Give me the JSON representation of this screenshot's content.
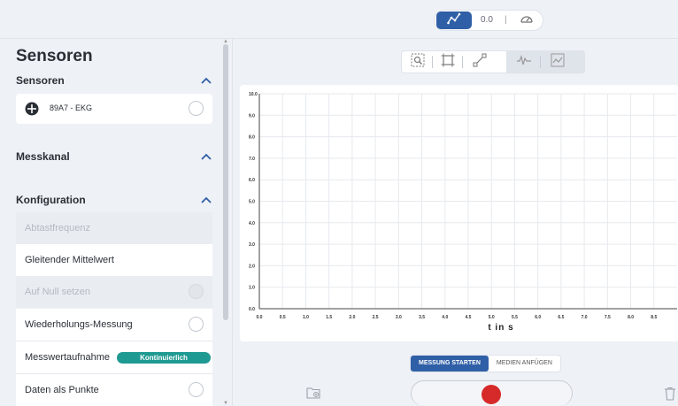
{
  "topbar": {
    "mode_value": "0.0",
    "mode_separator": "|",
    "icons": [
      "graph-mode-icon",
      "gauge-icon"
    ]
  },
  "sidebar": {
    "title": "Sensoren",
    "sensors": {
      "header": "Sensoren",
      "items": [
        {
          "label": "89A7 - EKG",
          "icon": "sensor-icon"
        }
      ]
    },
    "channel": {
      "header": "Messkanal"
    },
    "config": {
      "header": "Konfiguration",
      "rows": [
        {
          "label": "Abtastfrequenz"
        },
        {
          "label": "Gleitender Mittelwert"
        },
        {
          "label": "Auf Null setzen"
        },
        {
          "label": "Wiederholungs-Messung"
        },
        {
          "label": "Messwertaufnahme",
          "badge": "Kontinuierlich"
        },
        {
          "label": "Daten als Punkte"
        }
      ]
    }
  },
  "toolbar": {
    "icons": [
      "zoom-icon",
      "fit-icon",
      "line-tool-icon",
      "wave-icon",
      "auto-scale-icon"
    ],
    "separators": [
      "|",
      "|",
      "|"
    ]
  },
  "chart_data": {
    "type": "line",
    "xlabel": "t in s",
    "ylabel": "",
    "title": "",
    "xlim": [
      0.0,
      9.0
    ],
    "ylim": [
      0.0,
      10.0
    ],
    "x_ticks": [
      "0.0",
      "0.5",
      "1.0",
      "1.5",
      "2.0",
      "2.5",
      "3.0",
      "3.5",
      "4.0",
      "4.5",
      "5.0",
      "5.5",
      "6.0",
      "6.5",
      "7.0",
      "7.5",
      "8.0",
      "8.5"
    ],
    "y_ticks": [
      "10.0",
      "9.0",
      "8.0",
      "7.0",
      "6.0",
      "5.0",
      "4.0",
      "3.0",
      "2.0",
      "1.0",
      "0.0"
    ],
    "grid": true,
    "series": []
  },
  "actions": {
    "start_label": "MESSUNG STARTEN",
    "media_label": "MEDIEN ANFÜGEN"
  },
  "colors": {
    "accent": "#2f5fa6",
    "badge": "#1f9a92",
    "record": "#d62a2a"
  }
}
